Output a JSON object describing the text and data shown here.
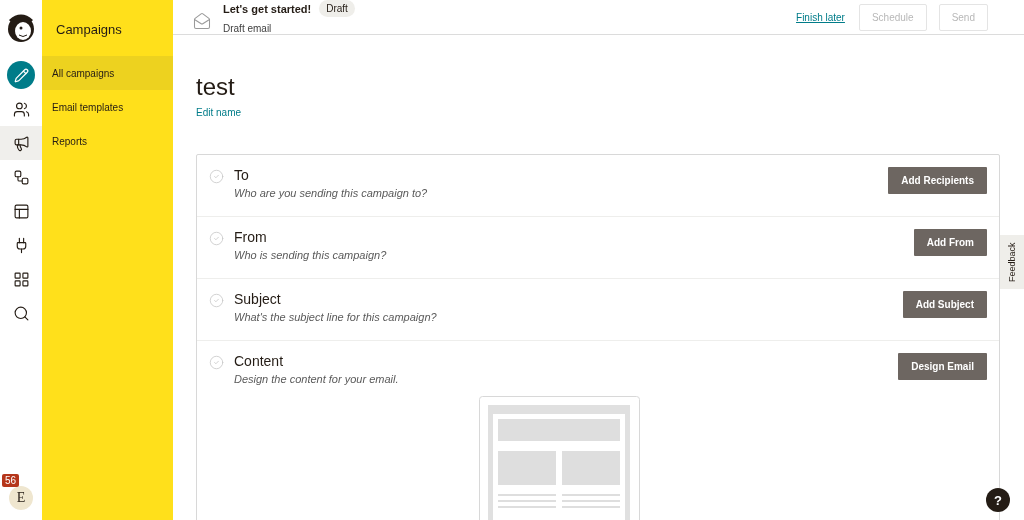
{
  "rail": {
    "items": [
      {
        "kind": "create",
        "selected": false
      },
      {
        "kind": "audience",
        "selected": false
      },
      {
        "kind": "campaigns",
        "selected": true
      },
      {
        "kind": "automation",
        "selected": false
      },
      {
        "kind": "website",
        "selected": false
      },
      {
        "kind": "integrations",
        "selected": false
      },
      {
        "kind": "apps",
        "selected": false
      },
      {
        "kind": "search",
        "selected": false
      }
    ],
    "account": {
      "initial": "E",
      "badge": "56"
    }
  },
  "sidebar": {
    "title": "Campaigns",
    "items": [
      {
        "label": "All campaigns",
        "selected": true
      },
      {
        "label": "Email templates",
        "selected": false
      },
      {
        "label": "Reports",
        "selected": false
      }
    ]
  },
  "header": {
    "title": "Let's get started!",
    "badge": "Draft",
    "subtitle": "Draft email",
    "actions": [
      {
        "kind": "link",
        "label": "Finish later",
        "disabled": false
      },
      {
        "kind": "button",
        "label": "Schedule",
        "disabled": true
      },
      {
        "kind": "button",
        "label": "Send",
        "disabled": true
      }
    ]
  },
  "campaign": {
    "name": "test",
    "edit_link": "Edit name"
  },
  "checklist": [
    {
      "title": "To",
      "hint": "Who are you sending this campaign to?",
      "button": "Add Recipients",
      "complete": false
    },
    {
      "title": "From",
      "hint": "Who is sending this campaign?",
      "button": "Add From",
      "complete": false
    },
    {
      "title": "Subject",
      "hint": "What's the subject line for this campaign?",
      "button": "Add Subject",
      "complete": false
    },
    {
      "title": "Content",
      "hint": "Design the content for your email.",
      "button": "Design Email",
      "complete": false
    }
  ],
  "feedback_tab": "Feedback",
  "help_button": "?"
}
